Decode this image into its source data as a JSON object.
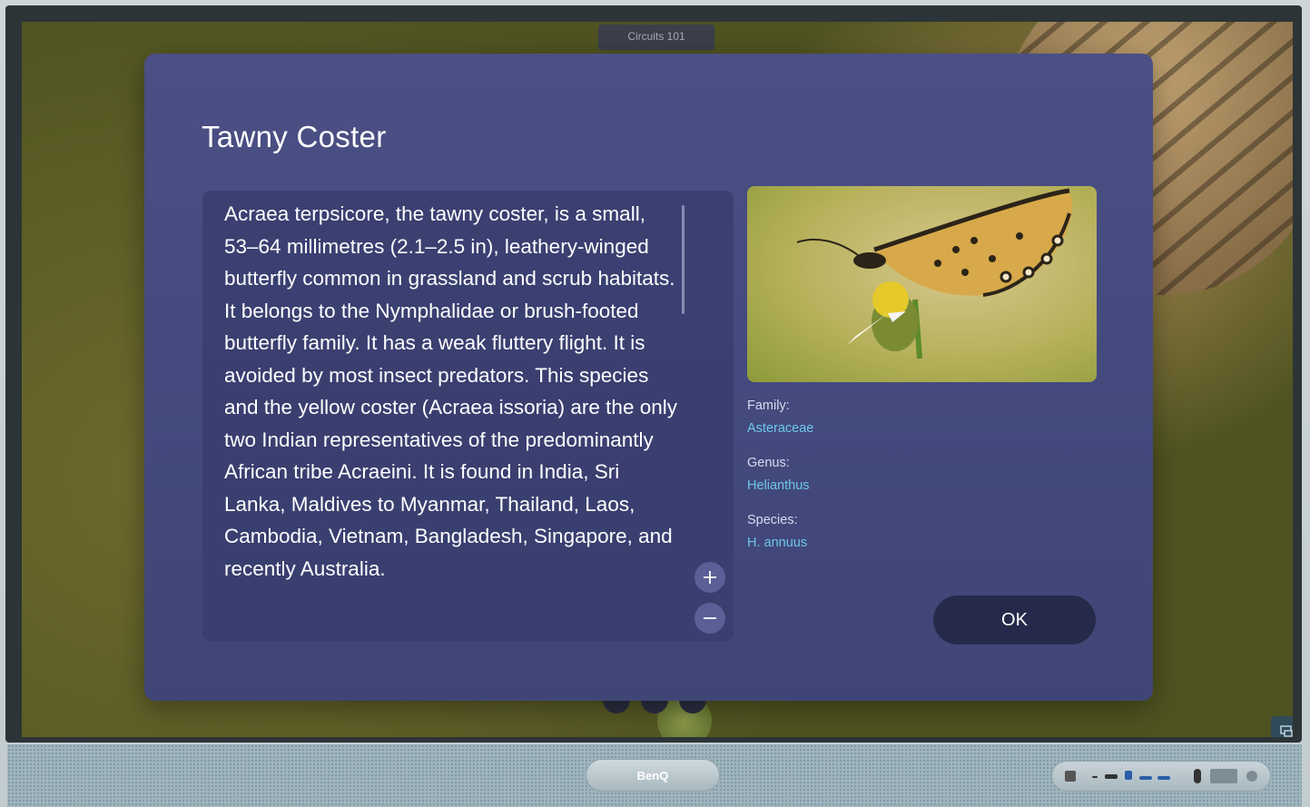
{
  "window": {
    "tab_title": "Circuits 101"
  },
  "dialog": {
    "title": "Tawny Coster",
    "description": "Acraea terpsicore, the tawny coster, is a small, 53–64 millimetres (2.1–2.5 in), leathery-winged butterfly common in grassland and scrub habitats. It belongs to the Nymphalidae or brush-footed butterfly family. It has a weak fluttery flight. It is avoided by most insect predators. This species and the yellow coster (Acraea issoria) are the only two Indian representatives of the predominantly African tribe Acraeini. It is found in India, Sri Lanka, Maldives to Myanmar, Thailand, Laos, Cambodia, Vietnam, Bangladesh, Singapore, and recently Australia.",
    "meta": [
      {
        "label": "Family:",
        "value": "Asteraceae"
      },
      {
        "label": "Genus:",
        "value": "Helianthus"
      },
      {
        "label": "Species:",
        "value": "H. annuus"
      }
    ],
    "ok_label": "OK",
    "zoom_in_icon": "plus-icon",
    "zoom_out_icon": "minus-icon"
  },
  "device": {
    "brand": "BenQ"
  },
  "colors": {
    "dialog_bg": "#464b80",
    "meta_value": "#6fc6ea",
    "ok_button": "#262a4a"
  }
}
